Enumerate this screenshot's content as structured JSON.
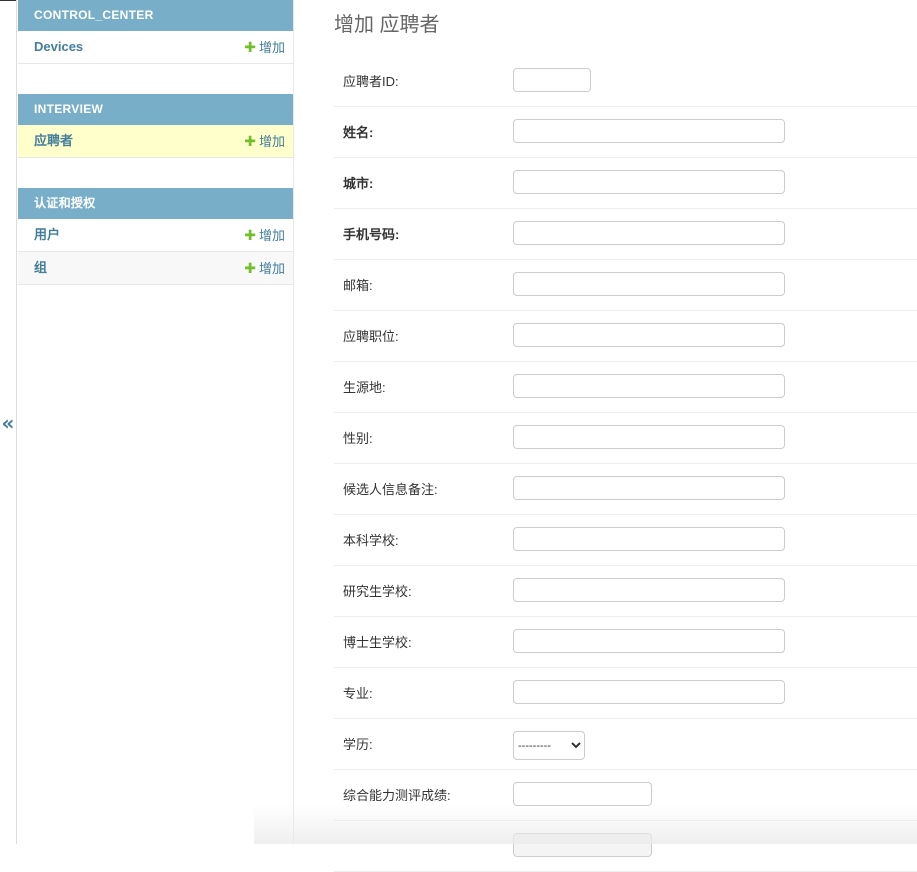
{
  "sidebar": {
    "collapse_glyph": "«",
    "modules": [
      {
        "title": "CONTROL_CENTER",
        "rows": [
          {
            "label": "Devices",
            "add": "增加"
          }
        ]
      },
      {
        "title": "INTERVIEW",
        "rows": [
          {
            "label": "应聘者",
            "add": "增加"
          }
        ]
      },
      {
        "title": "认证和授权",
        "rows": [
          {
            "label": "用户",
            "add": "增加"
          },
          {
            "label": "组",
            "add": "增加"
          }
        ]
      }
    ]
  },
  "main": {
    "title": "增加 应聘者",
    "fields": [
      {
        "label": "应聘者ID:",
        "value": ""
      },
      {
        "label": "姓名:",
        "value": ""
      },
      {
        "label": "城市:",
        "value": ""
      },
      {
        "label": "手机号码:",
        "value": ""
      },
      {
        "label": "邮箱:",
        "value": ""
      },
      {
        "label": "应聘职位:",
        "value": ""
      },
      {
        "label": "生源地:",
        "value": ""
      },
      {
        "label": "性别:",
        "value": ""
      },
      {
        "label": "候选人信息备注:",
        "value": ""
      },
      {
        "label": "本科学校:",
        "value": ""
      },
      {
        "label": "研究生学校:",
        "value": ""
      },
      {
        "label": "博士生学校:",
        "value": ""
      },
      {
        "label": "专业:",
        "value": ""
      },
      {
        "label": "学历:",
        "selected": "---------"
      },
      {
        "label": "综合能力测评成绩:",
        "value": ""
      },
      {
        "label": "",
        "value": ""
      }
    ]
  }
}
